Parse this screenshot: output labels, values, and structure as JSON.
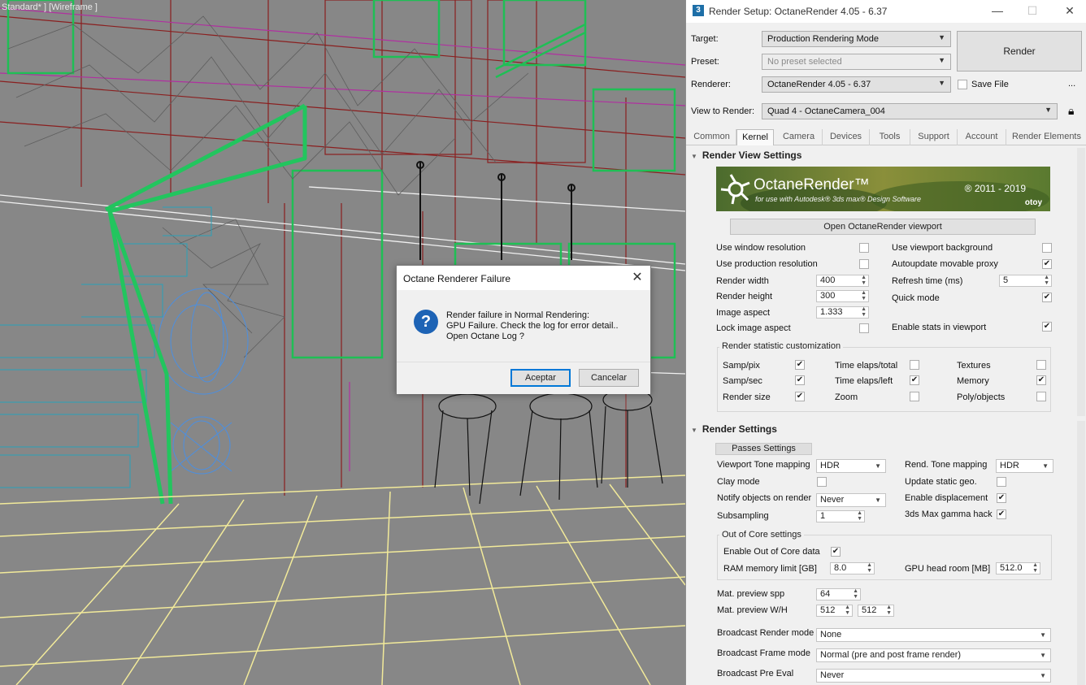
{
  "viewport": {
    "label": "Standard* ] [Wireframe ]"
  },
  "window": {
    "title": "Render Setup: OctaneRender 4.05 - 6.37",
    "icon": "3ds-max-icon"
  },
  "setup": {
    "target_label": "Target:",
    "target_value": "Production Rendering Mode",
    "preset_label": "Preset:",
    "preset_value": "No preset selected",
    "renderer_label": "Renderer:",
    "renderer_value": "OctaneRender 4.05 - 6.37",
    "view_label": "View to Render:",
    "view_value": "Quad 4 - OctaneCamera_004",
    "render_button": "Render",
    "save_file_label": "Save File",
    "more_label": "..."
  },
  "tabs": [
    "Common",
    "Kernel",
    "Camera",
    "Devices",
    "Tools",
    "Support",
    "Account",
    "Render Elements"
  ],
  "active_tab": "Kernel",
  "render_view": {
    "header": "Render View Settings",
    "banner": {
      "title": "OctaneRender™",
      "subtitle": "for use with Autodesk® 3ds max® Design Software",
      "years": "® 2011 - 2019",
      "brand": "otoy"
    },
    "open_viewport_button": "Open OctaneRender viewport",
    "use_window_resolution": "Use window resolution",
    "use_production_resolution": "Use production resolution",
    "render_width_label": "Render width",
    "render_width": "400",
    "render_height_label": "Render height",
    "render_height": "300",
    "image_aspect_label": "Image aspect",
    "image_aspect": "1.333",
    "lock_image_aspect": "Lock image aspect",
    "use_viewport_background": "Use viewport background",
    "autoupdate_movable_proxy": "Autoupdate movable proxy",
    "refresh_time_label": "Refresh time (ms)",
    "refresh_time": "5",
    "quick_mode": "Quick mode",
    "enable_stats": "Enable stats in viewport",
    "stat_group_title": "Render statistic customization",
    "stats": {
      "samp_pix": "Samp/pix",
      "samp_sec": "Samp/sec",
      "render_size": "Render size",
      "time_total": "Time elaps/total",
      "time_left": "Time elaps/left",
      "zoom": "Zoom",
      "textures": "Textures",
      "memory": "Memory",
      "poly_objects": "Poly/objects"
    }
  },
  "render_settings": {
    "header": "Render Settings",
    "passes_button": "Passes Settings",
    "viewport_tone_label": "Viewport Tone mapping",
    "viewport_tone_value": "HDR",
    "rend_tone_label": "Rend. Tone mapping",
    "rend_tone_value": "HDR",
    "clay_mode": "Clay mode",
    "update_static_geo": "Update static geo.",
    "notify_label": "Notify objects on render",
    "notify_value": "Never",
    "enable_displacement": "Enable displacement",
    "subsampling_label": "Subsampling",
    "subsampling_value": "1",
    "gamma_hack": "3ds Max gamma hack",
    "ooc_title": "Out of Core settings",
    "enable_ooc": "Enable Out of Core data",
    "ram_limit_label": "RAM memory limit [GB]",
    "ram_limit": "8.0",
    "gpu_headroom_label": "GPU head room [MB]",
    "gpu_headroom": "512.0",
    "mat_spp_label": "Mat. preview spp",
    "mat_spp": "64",
    "mat_wh_label": "Mat. preview W/H",
    "mat_w": "512",
    "mat_h": "512",
    "broadcast_mode_label": "Broadcast Render mode",
    "broadcast_mode": "None",
    "broadcast_frame_label": "Broadcast Frame mode",
    "broadcast_frame": "Normal (pre and post frame render)",
    "broadcast_pre_label": "Broadcast Pre Eval",
    "broadcast_pre": "Never"
  },
  "dialog": {
    "title": "Octane Renderer Failure",
    "line1": "Render failure in Normal Rendering:",
    "line2": "GPU Failure.  Check the log for error detail..",
    "line3": "Open Octane Log ?",
    "ok": "Aceptar",
    "cancel": "Cancelar"
  },
  "colors": {
    "accent": "#0078d7",
    "wire_green": "#22c55e",
    "wire_red": "#9b1b1b",
    "wire_blue": "#4c8fe0",
    "floor_lines": "#f2ea9a"
  }
}
